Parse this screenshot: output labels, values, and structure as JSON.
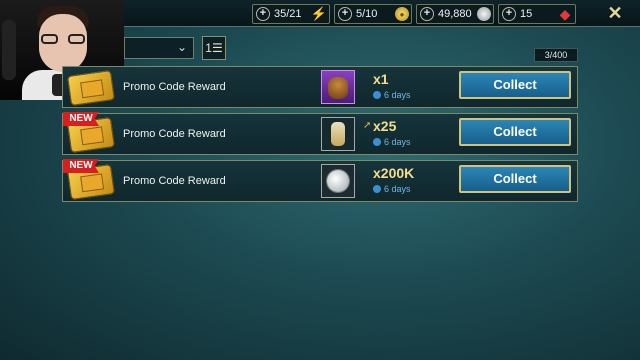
{
  "resources": [
    {
      "id": "energy",
      "value": "35/21",
      "icon": "energy-icon"
    },
    {
      "id": "keys",
      "value": "5/10",
      "icon": "gold-key-icon"
    },
    {
      "id": "silver",
      "value": "49,880",
      "icon": "silver-coin-icon"
    },
    {
      "id": "gems",
      "value": "15",
      "icon": "ruby-gem-icon"
    }
  ],
  "close_label": "✕",
  "filter": {
    "selected": ""
  },
  "inbox_count": "3/400",
  "rows": [
    {
      "new": false,
      "new_label": "",
      "label": "Promo Code Reward",
      "reward_icon": "hero-shard-icon",
      "qty": "x1",
      "time": "6 days",
      "button": "Collect"
    },
    {
      "new": true,
      "new_label": "NEW",
      "label": "Promo Code Reward",
      "reward_icon": "potion-icon",
      "qty": "x25",
      "time": "6 days",
      "button": "Collect"
    },
    {
      "new": true,
      "new_label": "NEW",
      "label": "Promo Code Reward",
      "reward_icon": "silver-coin-icon",
      "qty": "x200K",
      "time": "6 days",
      "button": "Collect"
    }
  ]
}
